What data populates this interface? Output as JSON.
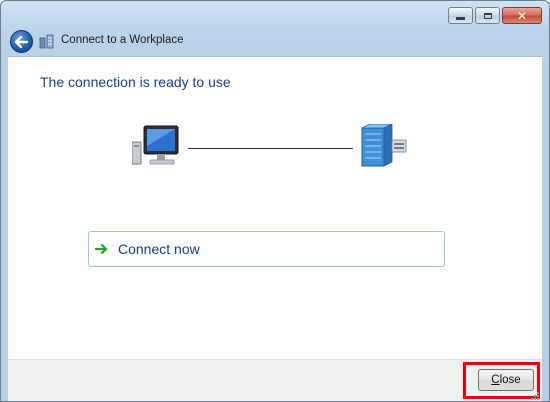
{
  "window": {
    "title": "Connect to a Workplace",
    "icons": {
      "back": "back-arrow-icon",
      "app": "workplace-network-icon"
    }
  },
  "caption_buttons": {
    "minimize": "minimize-icon",
    "maximize": "maximize-icon",
    "close": "close-icon"
  },
  "content": {
    "heading": "The connection is ready to use",
    "diagram": {
      "left_icon": "computer-icon",
      "right_icon": "workplace-server-icon"
    },
    "connect_now": {
      "label": "Connect now",
      "icon": "green-arrow-icon"
    }
  },
  "footer": {
    "close_label_first": "C",
    "close_label_rest": "lose",
    "highlight_color": "#e3000f"
  },
  "colors": {
    "heading": "#1e3f8f",
    "link": "#1a3d8a",
    "accent": "#2aa12a"
  }
}
